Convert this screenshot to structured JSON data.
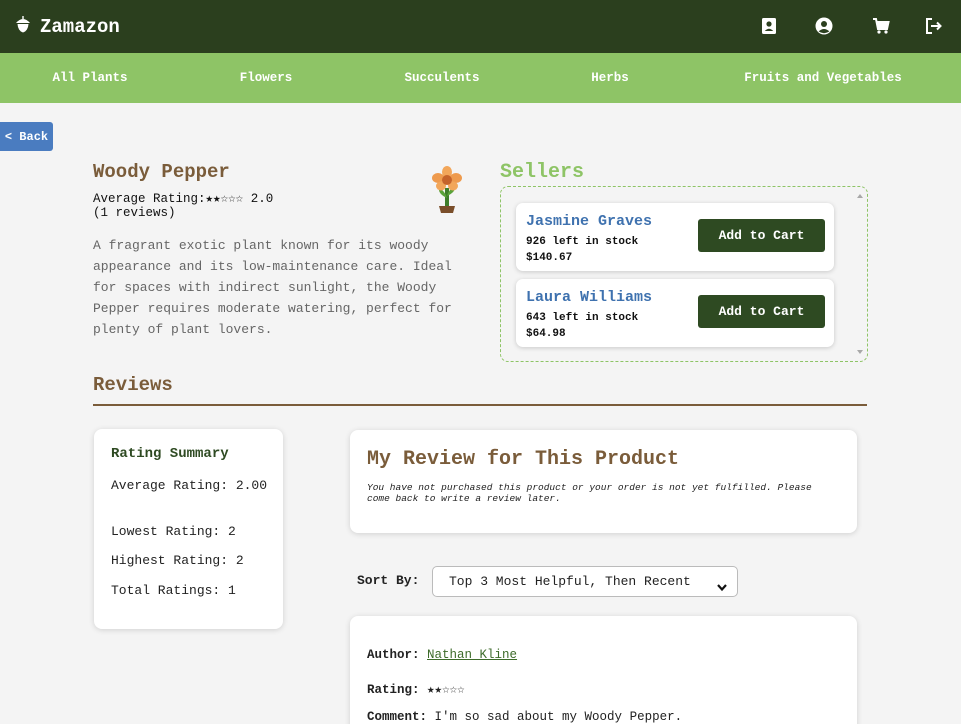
{
  "app": {
    "title": "Zamazon",
    "accent": "#8ec466",
    "dark": "#2b3f1e"
  },
  "header_icons": [
    "contact-book-icon",
    "user-account-icon",
    "cart-icon",
    "logout-icon"
  ],
  "categories": [
    "All Plants",
    "Flowers",
    "Succulents",
    "Herbs",
    "Fruits and Vegetables"
  ],
  "back_label": "< Back",
  "product": {
    "name": "Woody Pepper",
    "average_label": "Average Rating:",
    "stars": "★★☆☆☆",
    "average_value": "2.0",
    "review_count_text": "(1 reviews)",
    "description": "A fragrant exotic plant known for its woody appearance and its low-maintenance care. Ideal for spaces with indirect sunlight, the Woody Pepper requires moderate watering, perfect for plenty of plant lovers."
  },
  "sellers": {
    "title": "Sellers",
    "items": [
      {
        "name": "Jasmine Graves",
        "stock": "926 left in stock",
        "price": "$140.67",
        "button": "Add to Cart"
      },
      {
        "name": "Laura Williams",
        "stock": "643 left in stock",
        "price": "$64.98",
        "button": "Add to Cart"
      }
    ]
  },
  "reviews": {
    "title": "Reviews",
    "summary": {
      "title": "Rating Summary",
      "average": "Average Rating: 2.00",
      "lowest": "Lowest Rating: 2",
      "highest": "Highest Rating: 2",
      "total": "Total Ratings: 1"
    },
    "my_review": {
      "title": "My Review for This Product",
      "note": "You have not purchased this product or your order is not yet fulfilled. Please come back to write a review later."
    },
    "sort": {
      "label": "Sort By:",
      "selected": "Top 3 Most Helpful, Then Recent"
    },
    "list": [
      {
        "author_label": "Author:",
        "author": "Nathan Kline",
        "rating_label": "Rating:",
        "stars": "★★☆☆☆",
        "comment_label": "Comment:",
        "comment": "I'm so sad about my Woody Pepper."
      }
    ]
  }
}
